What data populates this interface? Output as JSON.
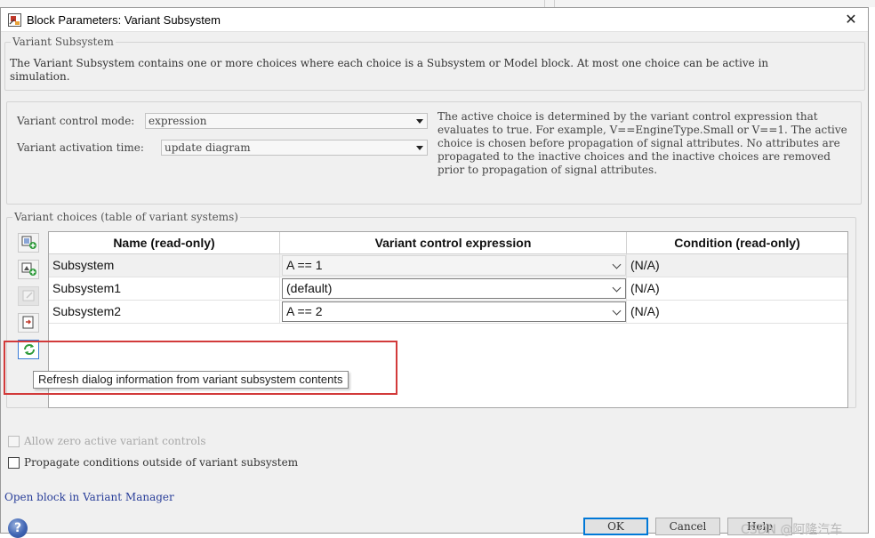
{
  "window": {
    "title": "Block Parameters: Variant Subsystem",
    "close_glyph": "✕"
  },
  "intro": {
    "legend": "Variant Subsystem",
    "description": "The Variant Subsystem contains one or more choices where each choice is a Subsystem or Model block. At most one choice can be active in simulation."
  },
  "settings": {
    "control_mode_label": "Variant control mode:",
    "control_mode_value": "expression",
    "activation_time_label": "Variant activation time:",
    "activation_time_value": "update diagram",
    "help_text": "The active choice is determined by the variant control expression that evaluates to true. For example, V==EngineType.Small or V==1. The active choice is chosen before propagation of signal attributes. No attributes are propagated to the inactive choices and the inactive choices are removed prior to propagation of signal attributes."
  },
  "choices": {
    "legend": "Variant choices (table of variant systems)",
    "columns": [
      "Name (read-only)",
      "Variant control expression",
      "Condition (read-only)"
    ],
    "rows": [
      {
        "name": "Subsystem",
        "expression": "A == 1",
        "condition": "(N/A)"
      },
      {
        "name": "Subsystem1",
        "expression": "(default)",
        "condition": "(N/A)"
      },
      {
        "name": "Subsystem2",
        "expression": "A == 2",
        "condition": "(N/A)"
      }
    ],
    "toolbar_icons": [
      "add-subsystem-icon",
      "add-model-icon",
      "edit-icon",
      "open-block-icon",
      "refresh-icon"
    ],
    "tooltip": "Refresh dialog information from variant subsystem contents"
  },
  "options": {
    "allow_zero_label": "Allow zero active variant controls",
    "allow_zero_checked": false,
    "propagate_label": "Propagate conditions outside of variant subsystem",
    "propagate_checked": false,
    "open_manager_link": "Open block in Variant Manager"
  },
  "footer": {
    "help_glyph": "?",
    "ok": "OK",
    "cancel": "Cancel",
    "help": "Help",
    "watermark": "CSDN @阿隆汽车"
  },
  "colors": {
    "highlight": "#d23a3a",
    "link": "#2a3f9a",
    "primary_border": "#0078d7"
  }
}
